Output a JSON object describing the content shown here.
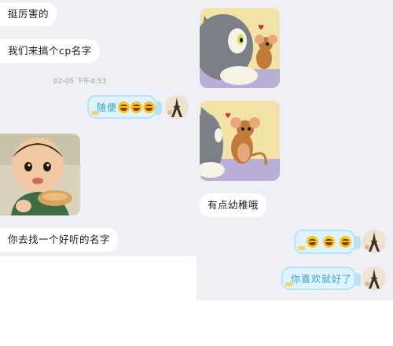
{
  "left_panel": {
    "messages": [
      {
        "text": "挺厉害的"
      },
      {
        "text": "我们来搞个cp名字"
      },
      {
        "text": "你去找一个好听的名字"
      }
    ],
    "timestamp": "02-05 下午4:53",
    "sent_messages": [
      {
        "text": "随便"
      }
    ]
  },
  "right_panel": {
    "messages": [
      {
        "text": "有点幼稚哦"
      }
    ],
    "sent_messages": [
      {
        "text": ""
      },
      {
        "text": "你喜欢就好了"
      }
    ]
  },
  "colors": {
    "chat_background": "#eef0f6",
    "incoming_bubble": "#ffffff",
    "outgoing_bubble": "#def3fb",
    "outgoing_text": "#3aa0cf"
  },
  "icons": [
    "laughing-emoji-icon",
    "eiffel-tower-avatar-icon"
  ]
}
